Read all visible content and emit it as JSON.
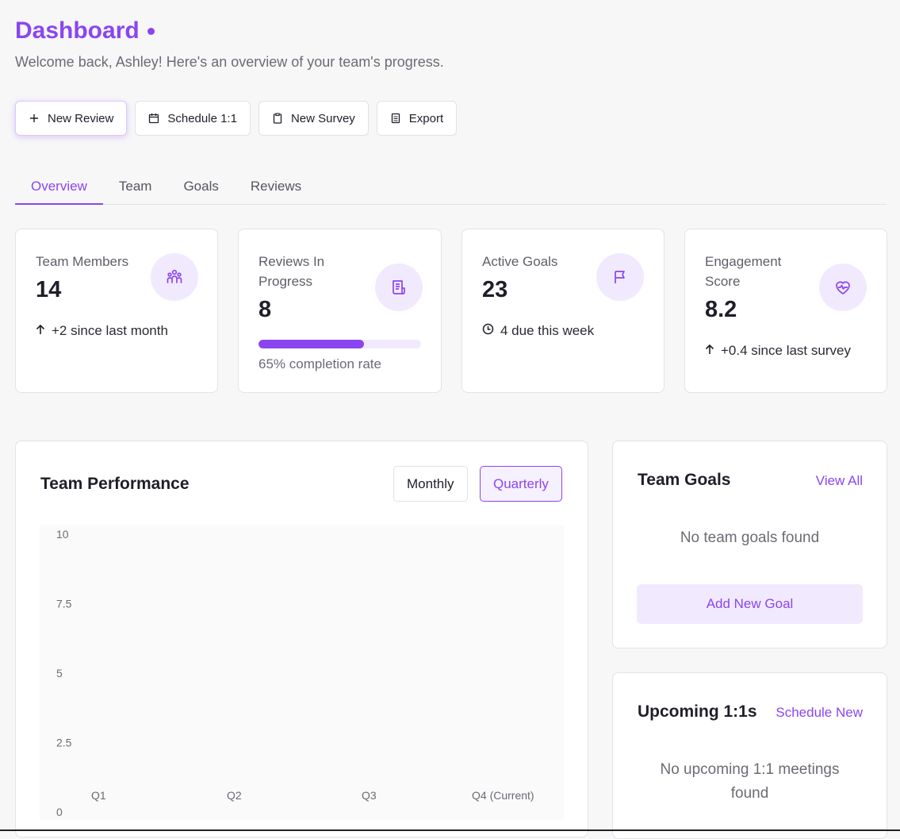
{
  "header": {
    "title": "Dashboard",
    "subtitle": "Welcome back, Ashley! Here's an overview of your team's progress."
  },
  "actions": {
    "new_review": "New Review",
    "schedule": "Schedule 1:1",
    "new_survey": "New Survey",
    "export": "Export"
  },
  "tabs": [
    {
      "label": "Overview",
      "active": true
    },
    {
      "label": "Team"
    },
    {
      "label": "Goals"
    },
    {
      "label": "Reviews"
    }
  ],
  "stats": {
    "team_members": {
      "label": "Team Members",
      "value": "14",
      "note": "+2 since last month"
    },
    "reviews": {
      "label_line1": "Reviews In",
      "label_line2": "Progress",
      "value": "8",
      "progress": 0.65,
      "note": "65% completion rate"
    },
    "goals": {
      "label": "Active Goals",
      "value": "23",
      "note": "4 due this week"
    },
    "engagement": {
      "label_line1": "Engagement",
      "label_line2": "Score",
      "value": "8.2",
      "note": "+0.4 since last survey"
    }
  },
  "performance": {
    "title": "Team Performance",
    "monthly": "Monthly",
    "quarterly": "Quarterly"
  },
  "chart_data": {
    "type": "bar",
    "categories": [
      "Q1",
      "Q2",
      "Q3",
      "Q4 (Current)"
    ],
    "series": [],
    "yticks": [
      "0",
      "2.5",
      "5",
      "7.5",
      "10"
    ],
    "ylim": [
      0,
      10
    ],
    "grid": false
  },
  "team_goals": {
    "title": "Team Goals",
    "view_all": "View All",
    "empty": "No team goals found",
    "add": "Add New Goal"
  },
  "upcoming": {
    "title": "Upcoming 1:1s",
    "schedule_new": "Schedule New",
    "empty_line1": "No upcoming 1:1 meetings",
    "empty_line2": "found"
  },
  "colors": {
    "accent": "#8b45f0",
    "accent_light": "#f1eafe"
  }
}
